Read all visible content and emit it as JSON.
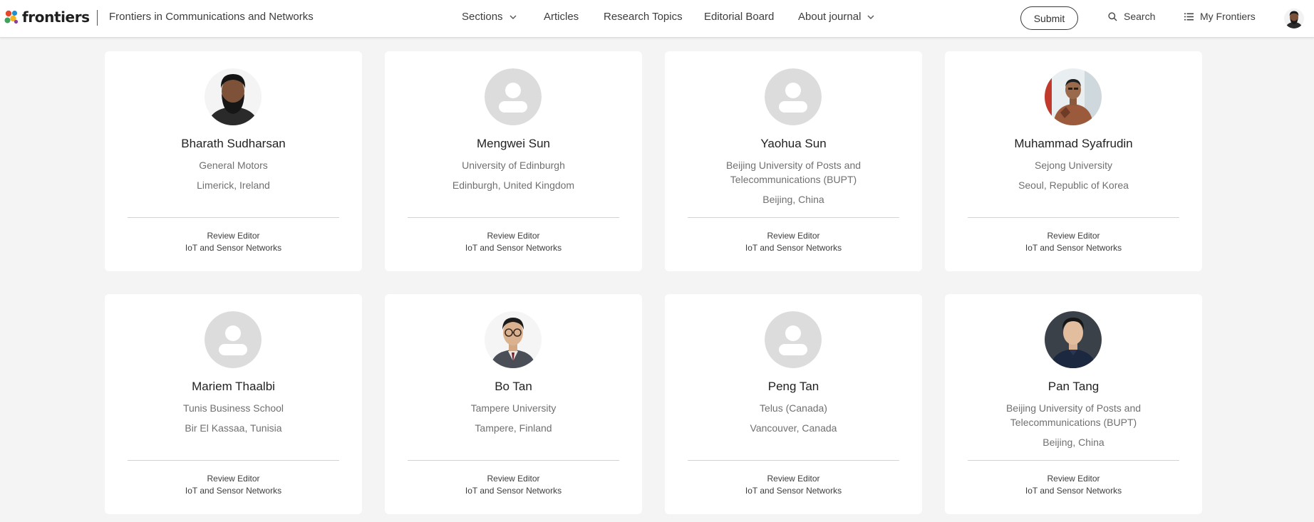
{
  "header": {
    "brand": "frontiers",
    "journal": "Frontiers in Communications and Networks",
    "nav": [
      {
        "label": "Sections",
        "dropdown": true
      },
      {
        "label": "Articles",
        "dropdown": false
      },
      {
        "label": "Research Topics",
        "dropdown": false
      },
      {
        "label": "Editorial Board",
        "dropdown": false
      },
      {
        "label": "About journal",
        "dropdown": true
      }
    ],
    "submit_label": "Submit",
    "search_label": "Search",
    "my_frontiers_label": "My Frontiers"
  },
  "editors": [
    {
      "name": "Bharath Sudharsan",
      "institution": "General Motors",
      "location": "Limerick, Ireland",
      "role": "Review Editor",
      "section": "IoT and Sensor Networks",
      "photo": "man-black-beard-photo"
    },
    {
      "name": "Mengwei Sun",
      "institution": "University of Edinburgh",
      "location": "Edinburgh, United Kingdom",
      "role": "Review Editor",
      "section": "IoT and Sensor Networks",
      "photo": "placeholder"
    },
    {
      "name": "Yaohua Sun",
      "institution": "Beijing University of Posts and Telecommunications (BUPT)",
      "location": "Beijing, China",
      "role": "Review Editor",
      "section": "IoT and Sensor Networks",
      "photo": "placeholder"
    },
    {
      "name": "Muhammad Syafrudin",
      "institution": "Sejong University",
      "location": "Seoul, Republic of Korea",
      "role": "Review Editor",
      "section": "IoT and Sensor Networks",
      "photo": "man-speaking-batik-photo"
    },
    {
      "name": "Mariem Thaalbi",
      "institution": "Tunis Business School",
      "location": "Bir El Kassaa, Tunisia",
      "role": "Review Editor",
      "section": "IoT and Sensor Networks",
      "photo": "placeholder"
    },
    {
      "name": "Bo Tan",
      "institution": "Tampere University",
      "location": "Tampere, Finland",
      "role": "Review Editor",
      "section": "IoT and Sensor Networks",
      "photo": "man-glasses-suit-photo"
    },
    {
      "name": "Peng Tan",
      "institution": "Telus (Canada)",
      "location": "Vancouver, Canada",
      "role": "Review Editor",
      "section": "IoT and Sensor Networks",
      "photo": "placeholder"
    },
    {
      "name": "Pan Tang",
      "institution": "Beijing University of Posts and Telecommunications (BUPT)",
      "location": "Beijing, China",
      "role": "Review Editor",
      "section": "IoT and Sensor Networks",
      "photo": "man-navy-shirt-photo"
    }
  ],
  "colors": {
    "page_bg": "#f4f4f4",
    "card_bg": "#ffffff",
    "placeholder_circle": "#dcdcdc",
    "logo": [
      "#e8462b",
      "#1f8fd1",
      "#f3b320",
      "#3aa55a",
      "#8a3f9e"
    ]
  }
}
